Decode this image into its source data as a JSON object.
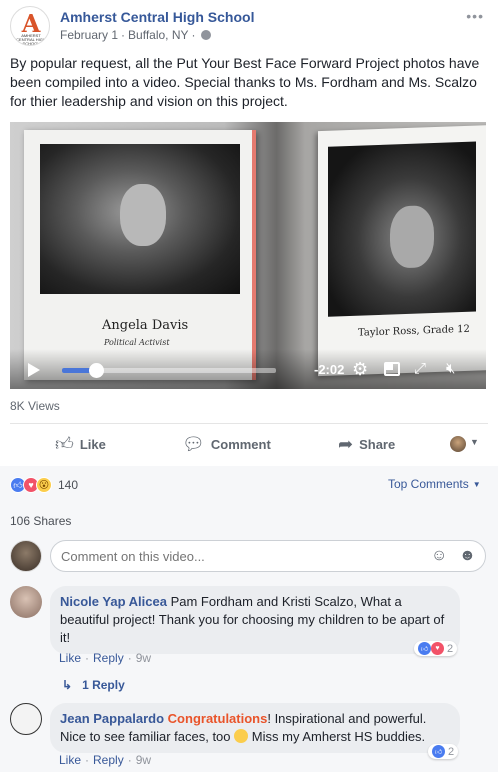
{
  "post": {
    "page_name": "Amherst Central High School",
    "avatar_letter": "A",
    "avatar_subtext": "AMHERST CENTRAL HIGH SCHOOL",
    "date": "February 1",
    "location": "Buffalo, NY",
    "separator": "·",
    "text": "By popular request, all the Put Your Best Face Forward Project photos have been compiled into a video. Special thanks to Ms. Fordham and Ms. Scalzo for thier leadership and vision on this project."
  },
  "video": {
    "caption_left_name": "Angela Davis",
    "caption_left_sub": "Political Activist",
    "caption_right": "Taylor Ross, Grade 12",
    "time_remaining": "-2:02",
    "progress_fraction": 0.16,
    "accent": "#4a76d8"
  },
  "stats": {
    "views": "8K Views",
    "reaction_count": "140",
    "shares": "106 Shares"
  },
  "actions": {
    "like": "Like",
    "comment": "Comment",
    "share": "Share"
  },
  "sort": {
    "label": "Top Comments"
  },
  "composer": {
    "placeholder": "Comment on this video..."
  },
  "comments": [
    {
      "author": "Nicole Yap Alicea",
      "text": "Pam Fordham and Kristi Scalzo, What a beautiful project! Thank you for choosing my children to be apart of it!",
      "like": "Like",
      "reply": "Reply",
      "time": "9w",
      "reaction_count": "2"
    },
    {
      "author": "Jean Pappalardo",
      "highlight": "Congratulations",
      "text_after_highlight": "! Inspirational and powerful. Nice to see familiar faces, too",
      "text_after_emoji": "Miss my Amherst HS buddies.",
      "like": "Like",
      "reply": "Reply",
      "time": "9w",
      "reaction_count": "2"
    }
  ],
  "replies_link": "1 Reply",
  "icons": {
    "more": "more-icon",
    "globe": "globe-icon",
    "play": "play-icon",
    "settings": "gear-icon",
    "pip": "pip-icon",
    "expand": "expand-icon",
    "mute": "mute-icon",
    "like": "thumbs-up-icon",
    "comment": "comment-bubble-icon",
    "share": "share-arrow-icon",
    "emoji": "emoji-icon",
    "sticker": "sticker-icon",
    "reply_arrow": "reply-arrow-icon"
  },
  "colors": {
    "link": "#385898",
    "page_name": "#365899",
    "love": "#f25268",
    "like": "#4a7cf0",
    "highlight": "#e9542a"
  }
}
